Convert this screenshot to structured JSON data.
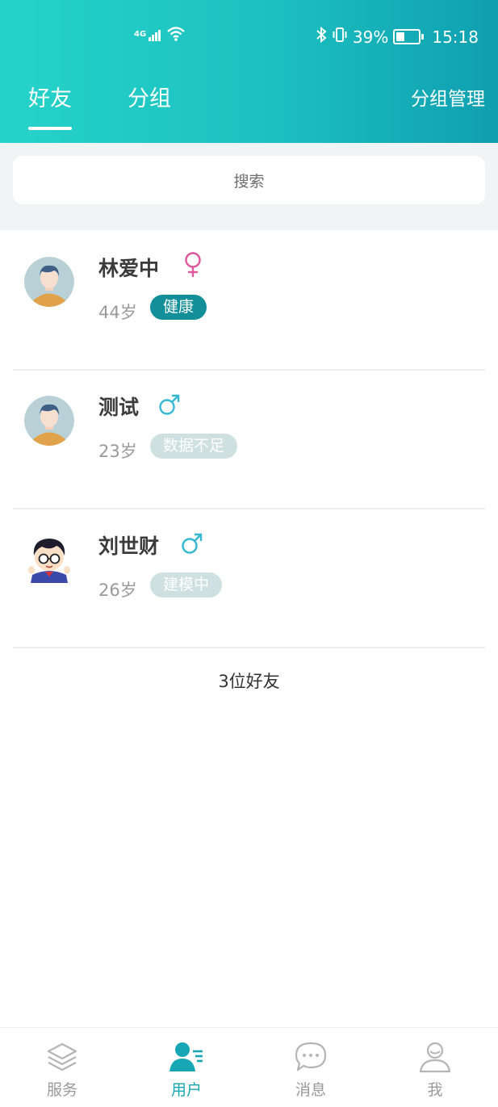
{
  "status_bar": {
    "network": "4G",
    "battery": "39%",
    "battery_level": 0.39,
    "time": "15:18"
  },
  "header": {
    "tabs": [
      {
        "label": "好友",
        "active": true
      },
      {
        "label": "分组",
        "active": false
      }
    ],
    "manage_label": "分组管理"
  },
  "search": {
    "placeholder": "搜索"
  },
  "friends": [
    {
      "name": "林爱中",
      "gender": "female",
      "gender_symbol": "♀",
      "age": "44岁",
      "status": "健康",
      "status_style": "health",
      "avatar": "default-avatar-icon"
    },
    {
      "name": "测试",
      "gender": "male",
      "gender_symbol": "♂",
      "age": "23岁",
      "status": "数据不足",
      "status_style": "muted",
      "avatar": "default-avatar-icon"
    },
    {
      "name": "刘世财",
      "gender": "male",
      "gender_symbol": "♂",
      "age": "26岁",
      "status": "建模中",
      "status_style": "muted",
      "avatar": "cartoon-avatar-icon"
    }
  ],
  "friend_count_label": "3位好友",
  "bottom_nav": [
    {
      "label": "服务",
      "icon": "layers-icon",
      "active": false
    },
    {
      "label": "用户",
      "icon": "user-list-icon",
      "active": true
    },
    {
      "label": "消息",
      "icon": "chat-bubble-icon",
      "active": false
    },
    {
      "label": "我",
      "icon": "person-icon",
      "active": false
    }
  ],
  "colors": {
    "header_gradient_start": "#26d3c9",
    "header_gradient_end": "#0f9fb0",
    "accent": "#17a7b4",
    "female": "#e0569a",
    "male": "#35b8d4",
    "badge_health": "#138f99",
    "badge_muted": "#cfe0e1"
  }
}
